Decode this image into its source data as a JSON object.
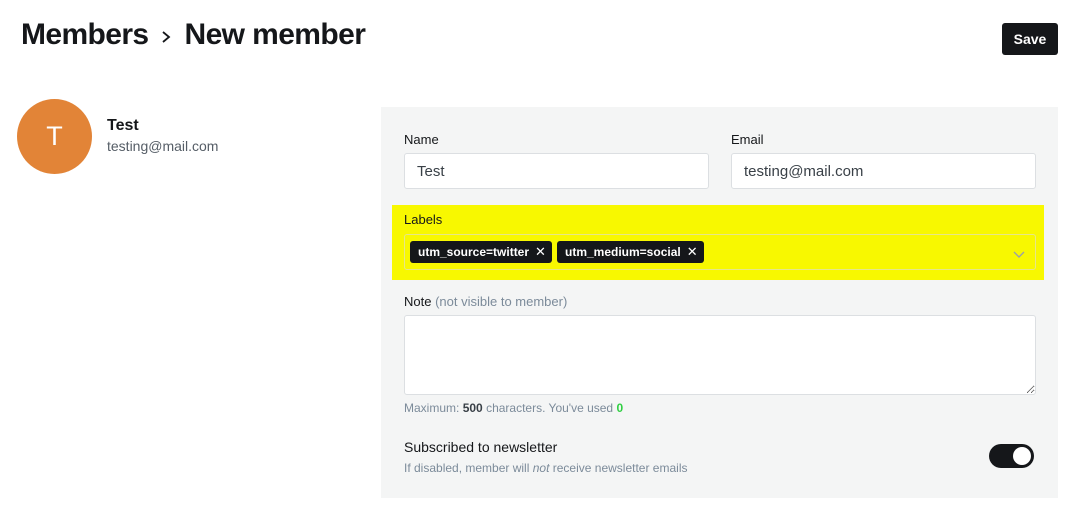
{
  "header": {
    "breadcrumb_parent": "Members",
    "title": "New member",
    "save_label": "Save"
  },
  "profile": {
    "initial": "T",
    "name": "Test",
    "email": "testing@mail.com",
    "avatar_color": "#e28437"
  },
  "form": {
    "name_label": "Name",
    "name_value": "Test",
    "email_label": "Email",
    "email_value": "testing@mail.com",
    "labels_label": "Labels",
    "labels": [
      "utm_source=twitter",
      "utm_medium=social"
    ],
    "highlight_color": "#f8f800",
    "note_label": "Note",
    "note_hint": "(not visible to member)",
    "note_value": "",
    "char_hint_prefix": "Maximum:",
    "char_max": "500",
    "char_hint_mid": "characters. You've used",
    "char_used": "0",
    "newsletter_title": "Subscribed to newsletter",
    "newsletter_desc_before": "If disabled, member will",
    "newsletter_desc_em": "not",
    "newsletter_desc_after": "receive newsletter emails",
    "newsletter_enabled": true
  },
  "icons": {
    "breadcrumb_separator": "chevron-right-icon",
    "tag_remove": "close-icon",
    "dropdown": "chevron-down-icon"
  }
}
